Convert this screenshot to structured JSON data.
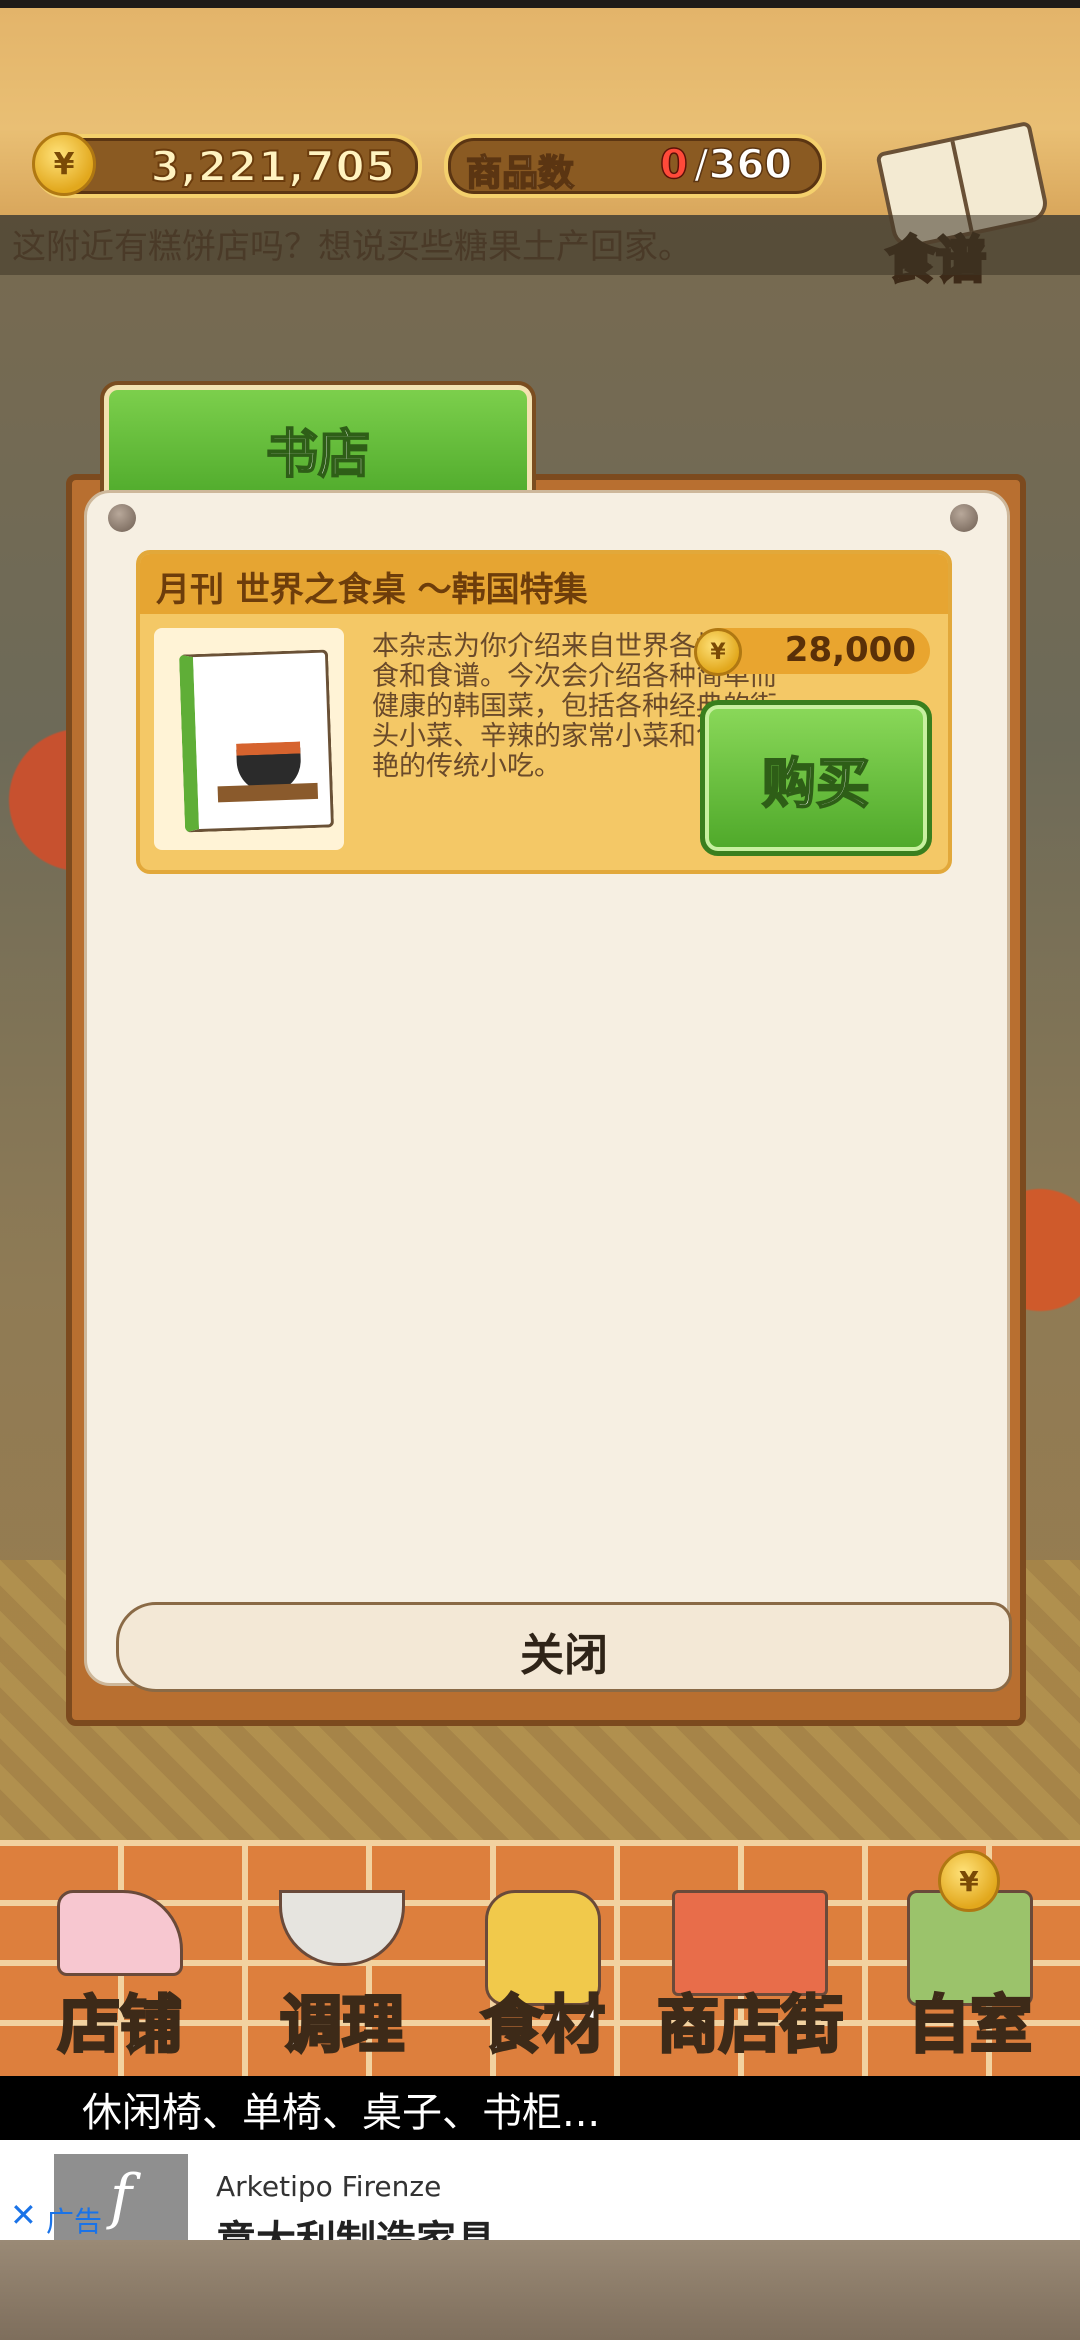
{
  "top_bar": {
    "coin_icon": "yen-coin-icon",
    "coin_symbol": "¥",
    "coins": "3,221,705",
    "item_count_label": "商品数",
    "item_count_current": "0",
    "item_count_max": "/360",
    "recipe_label": "食谱"
  },
  "narration": "这附近有糕饼店吗？想说买些糖果土产回家。",
  "dialog": {
    "tab_title": "书店",
    "item": {
      "title": "月刊  世界之食桌 ～韩国特集",
      "description": "本杂志为你介绍来自世界各地的美食和食谱。今次会介绍各种简单而健康的韩国菜，包括各种经典的街头小菜、辛辣的家常小菜和色彩鲜艳的传统小吃。",
      "price": "28,000",
      "price_symbol": "¥",
      "buy_label": "购买"
    },
    "close_label": "关闭"
  },
  "bottom_nav": {
    "items": [
      {
        "label": "店铺",
        "icon": "cake-icon"
      },
      {
        "label": "调理",
        "icon": "mixing-bowl-icon"
      },
      {
        "label": "食材",
        "icon": "flour-sack-icon"
      },
      {
        "label": "商店街",
        "icon": "storefront-icon"
      },
      {
        "label": "自室",
        "icon": "staff-room-door-icon"
      }
    ],
    "room_badge_symbol": "¥"
  },
  "ad": {
    "top_text": "休闲椅、单椅、桌子、书柜...",
    "close_symbol": "✕",
    "tag": "广告",
    "logo_letter": "f",
    "advertiser": "Arketipo Firenze",
    "headline": "意大利制造家具"
  },
  "colors": {
    "accent_green": "#5fb533",
    "gold": "#e9a52f",
    "board_brown": "#b86f30"
  }
}
